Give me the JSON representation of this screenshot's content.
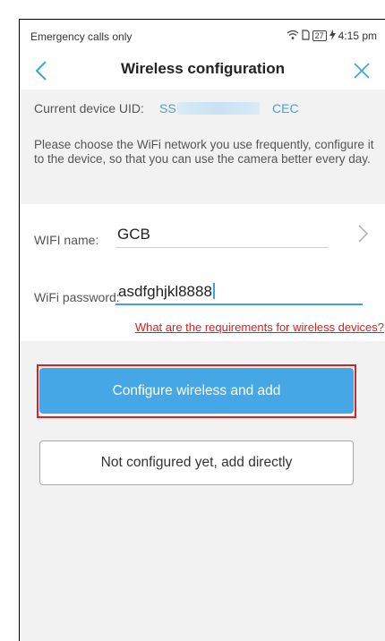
{
  "status_bar": {
    "carrier_text": "Emergency calls only",
    "battery_level": "27",
    "time": "4:15 pm"
  },
  "nav": {
    "title": "Wireless configuration"
  },
  "device": {
    "uid_label": "Current device UID:",
    "uid_prefix": "SS",
    "uid_suffix": "CEC"
  },
  "tip": {
    "text": "Please choose the WiFi network you use frequently, configure it to the device, so that you can use the camera better every day."
  },
  "form": {
    "wifi_name_label": "WIFI name:",
    "wifi_name_value": "GCB",
    "wifi_password_label": "WiFi password:",
    "wifi_password_value": "asdfghjkl8888",
    "requirements_link": "What are the requirements for wireless devices?"
  },
  "actions": {
    "configure_label": "Configure wireless and add",
    "skip_label": "Not configured yet, add directly"
  },
  "colors": {
    "accent": "#45a7e6",
    "link_red": "#d9201f",
    "uid_blue": "#3ca4e0"
  }
}
